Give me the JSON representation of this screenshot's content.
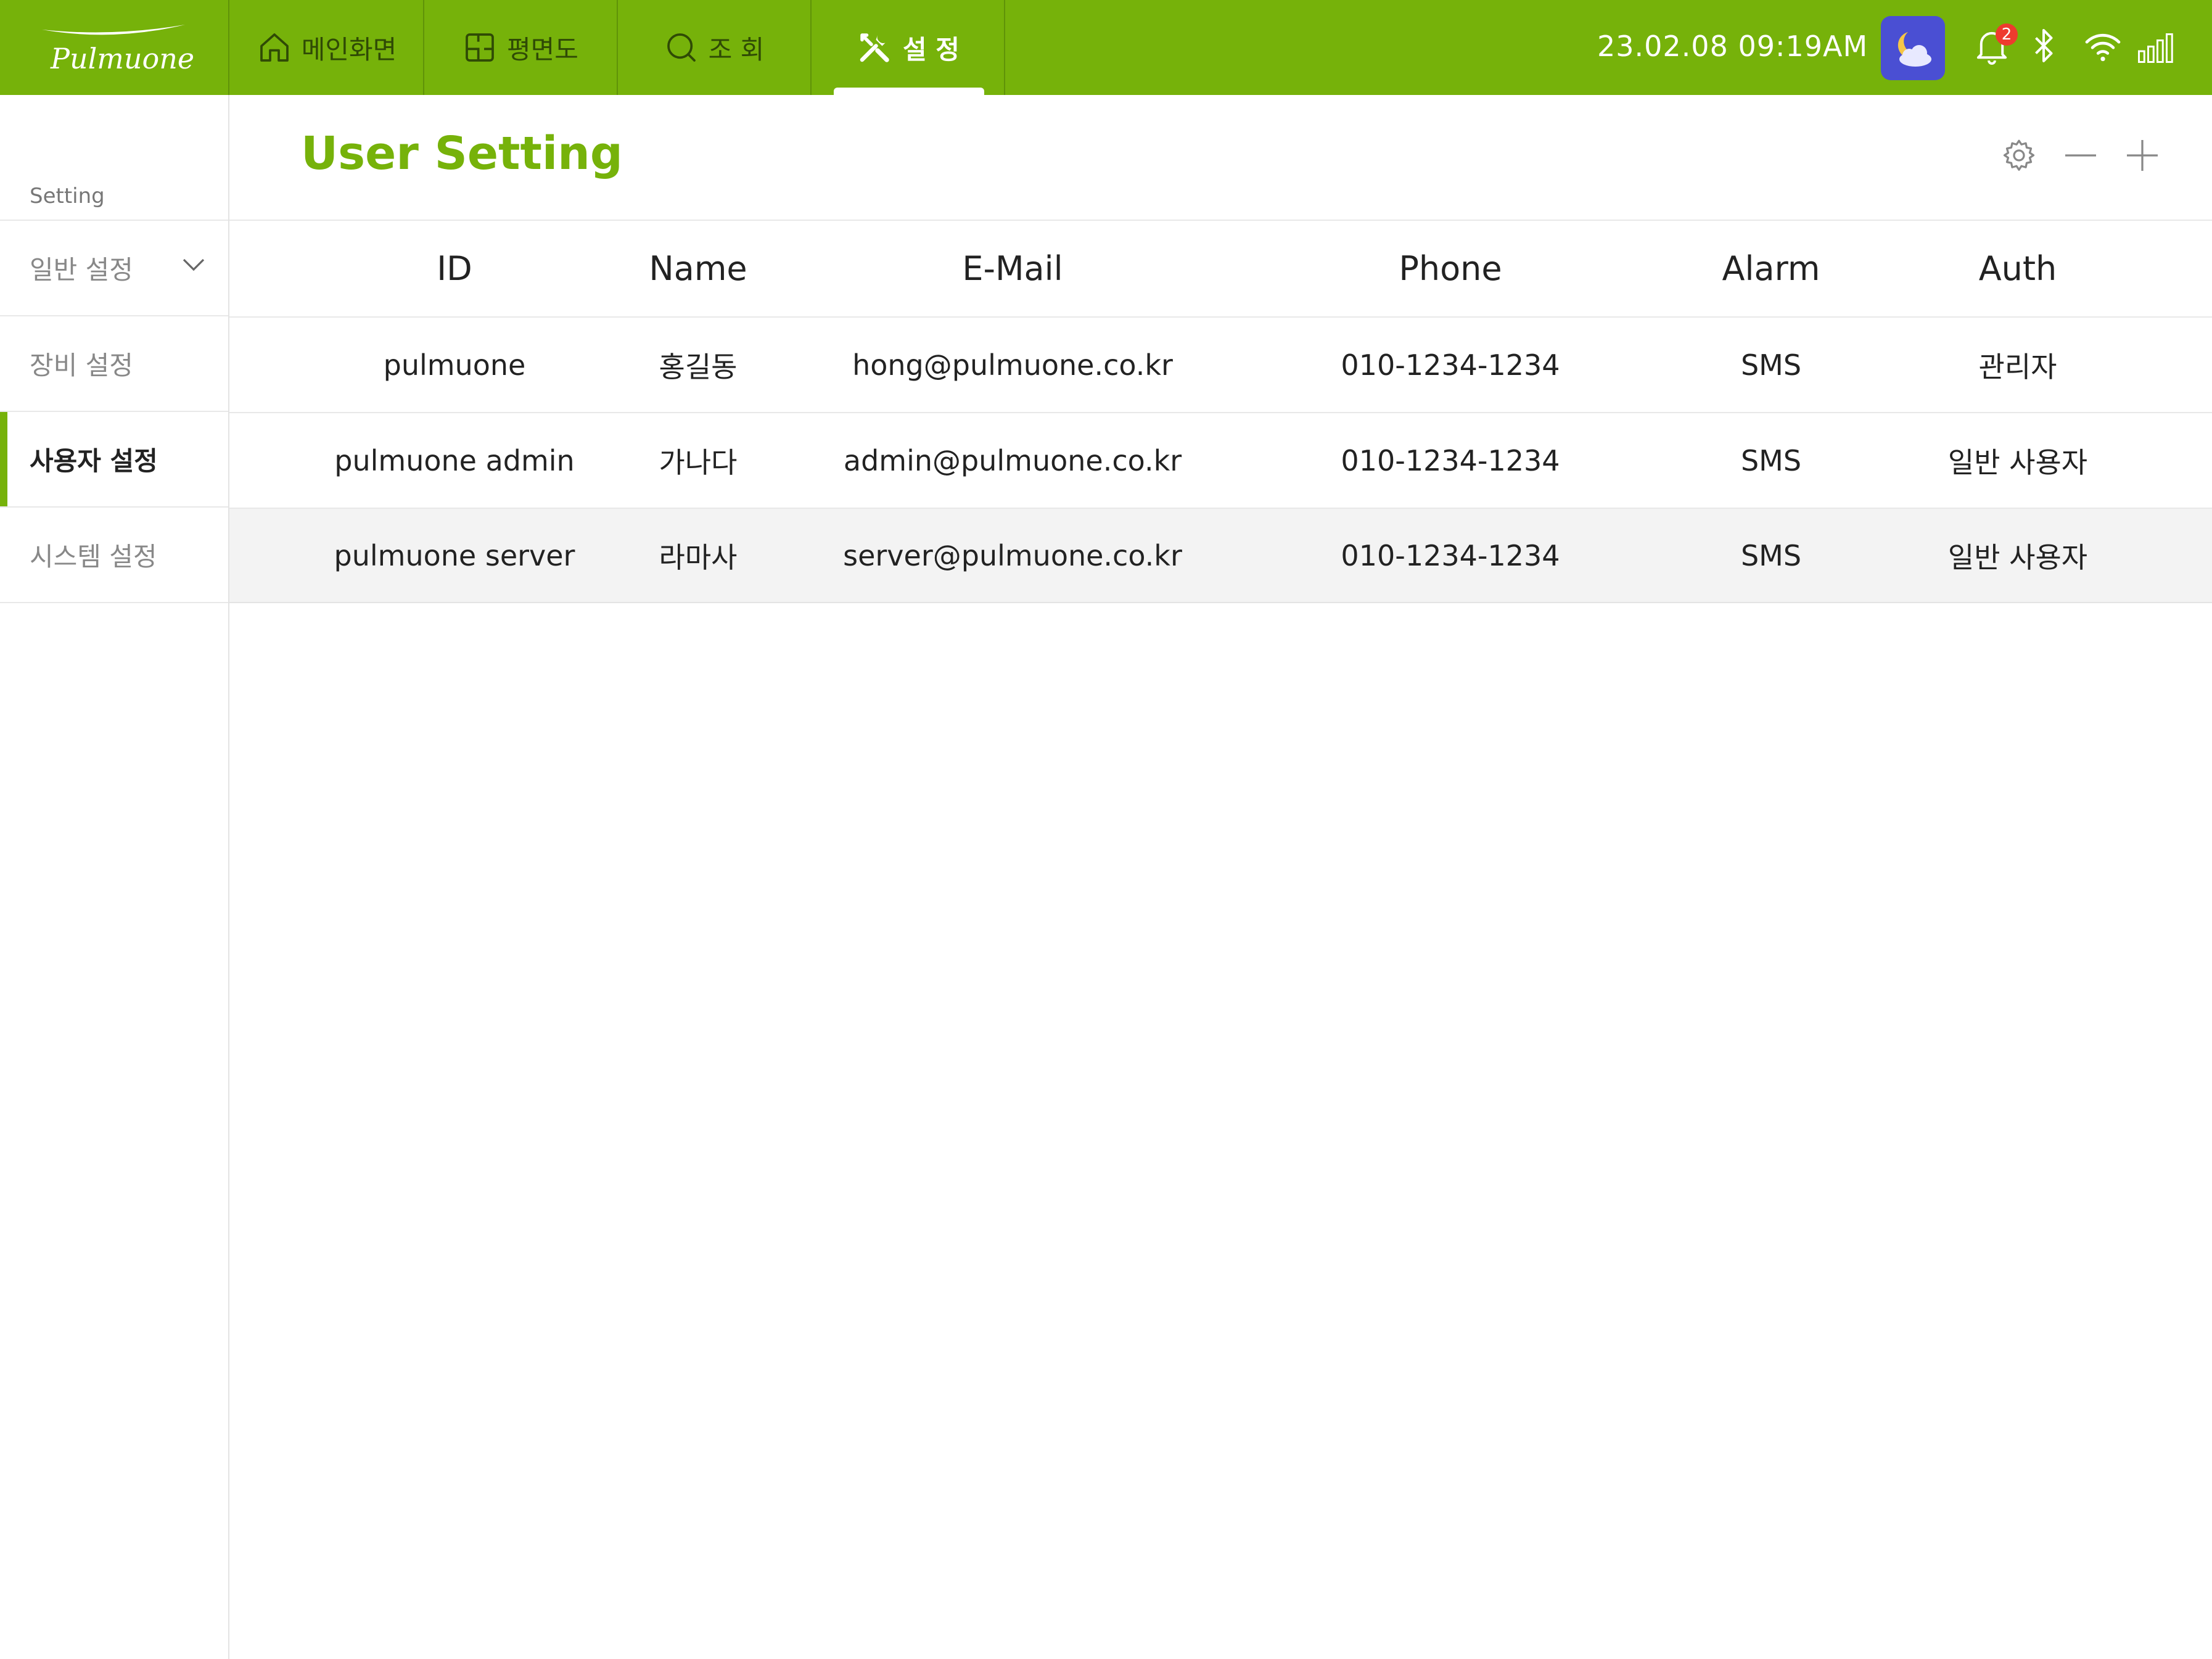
{
  "brand": {
    "name": "Pulmuone"
  },
  "nav": {
    "tabs": [
      {
        "label": "메인화면",
        "icon": "home-icon"
      },
      {
        "label": "평면도",
        "icon": "floorplan-icon"
      },
      {
        "label": "조 회",
        "icon": "search-icon"
      },
      {
        "label": "설 정",
        "icon": "tools-icon",
        "active": true
      }
    ]
  },
  "status": {
    "datetime": "23.02.08  09:19AM",
    "weather_icon": "moon-cloud-icon",
    "notification_count": "2"
  },
  "sidebar": {
    "heading": "Setting",
    "items": [
      {
        "label": "일반 설정",
        "expandable": true
      },
      {
        "label": "장비 설정"
      },
      {
        "label": "사용자 설정",
        "active": true
      },
      {
        "label": "시스템 설정"
      }
    ]
  },
  "main": {
    "title": "User Setting",
    "table": {
      "headers": {
        "id": "ID",
        "name": "Name",
        "email": "E-Mail",
        "phone": "Phone",
        "alarm": "Alarm",
        "auth": "Auth"
      },
      "rows": [
        {
          "id": "pulmuone",
          "name": "홍길동",
          "email": "hong@pulmuone.co.kr",
          "phone": "010-1234-1234",
          "alarm": "SMS",
          "auth": "관리자"
        },
        {
          "id": "pulmuone admin",
          "name": "가나다",
          "email": "admin@pulmuone.co.kr",
          "phone": "010-1234-1234",
          "alarm": "SMS",
          "auth": "일반 사용자"
        },
        {
          "id": "pulmuone server",
          "name": "라마사",
          "email": "server@pulmuone.co.kr",
          "phone": "010-1234-1234",
          "alarm": "SMS",
          "auth": "일반 사용자"
        }
      ]
    }
  },
  "colors": {
    "accent": "#76b20a",
    "weather_bg": "#4a4fd3",
    "badge": "#ee3b2e"
  }
}
